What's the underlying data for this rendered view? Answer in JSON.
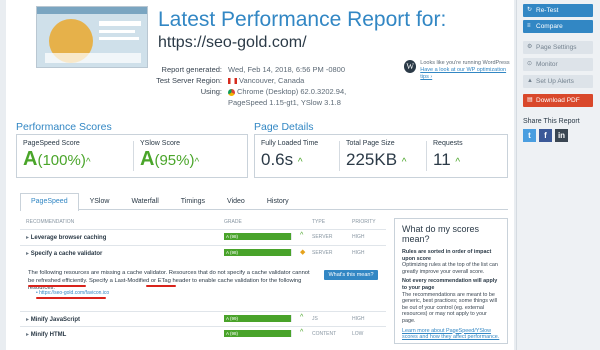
{
  "header": {
    "title": "Latest Performance Report for:",
    "url": "https://seo-gold.com/",
    "meta": [
      {
        "k": "Report generated:",
        "v": "Wed, Feb 14, 2018, 6:56 PM -0800"
      },
      {
        "k": "Test Server Region:",
        "v": "Vancouver, Canada"
      },
      {
        "k": "Using:",
        "v": "Chrome (Desktop) 62.0.3202.94, PageSpeed 1.15-gt1, YSlow 3.1.8"
      }
    ],
    "wp_text": "Looks like you're running WordPress",
    "wp_link": "Have a look at our WP optimization tips ›"
  },
  "scores": {
    "title": "Performance Scores",
    "pagespeed_label": "PageSpeed Score",
    "pagespeed_grade": "A",
    "pagespeed_pct": "(100%)",
    "yslow_label": "YSlow Score",
    "yslow_grade": "A",
    "yslow_pct": "(95%)"
  },
  "details": {
    "title": "Page Details",
    "loaded_label": "Fully Loaded Time",
    "loaded_value": "0.6s",
    "size_label": "Total Page Size",
    "size_value": "225KB",
    "requests_label": "Requests",
    "requests_value": "11"
  },
  "tabs": [
    "PageSpeed",
    "YSlow",
    "Waterfall",
    "Timings",
    "Video",
    "History"
  ],
  "table": {
    "headers": {
      "rec": "RECOMMENDATION",
      "grade": "GRADE",
      "type": "TYPE",
      "priority": "PRIORITY"
    },
    "rows": [
      {
        "name": "Leverage browser caching",
        "grade": "A (98)",
        "pct": 98,
        "type": "SERVER",
        "priority": "HIGH"
      },
      {
        "name": "Specify a cache validator",
        "grade": "A (98)",
        "pct": 98,
        "type": "SERVER",
        "priority": "HIGH"
      },
      {
        "name": "Minify JavaScript",
        "grade": "A (99)",
        "pct": 99,
        "type": "JS",
        "priority": "HIGH"
      },
      {
        "name": "Minify HTML",
        "grade": "A (98)",
        "pct": 98,
        "type": "CONTENT",
        "priority": "LOW"
      }
    ],
    "explanation": "The following resources are missing a cache validator. Resources that do not specify a cache validator cannot be refreshed efficiently. Specify a Last-Modified or ETag header to enable cache validation for the following resources:",
    "button": "What's this mean?",
    "resource": "• https://seo-gold.com/favicon.ico"
  },
  "infobox": {
    "title": "What do my scores mean?",
    "b1": "Rules are sorted in order of impact upon score",
    "p1": "Optimizing rules at the top of the list can greatly improve your overall score.",
    "b2": "Not every recommendation will apply to your page",
    "p2": "The recommendations are meant to be generic, best practices; some things will be out of your control (eg. external resources) or may not apply to your page.",
    "link": "Learn more about PageSpeed/YSlow scores and how they affect performance."
  },
  "sidebar": {
    "retest": "Re-Test",
    "compare": "Compare",
    "page_settings": "Page Settings",
    "monitor": "Monitor",
    "alerts": "Set Up Alerts",
    "pdf": "Download PDF",
    "share_title": "Share This Report"
  },
  "colors": {
    "accent": "#3287c4",
    "good": "#49a32a",
    "danger": "#d9482b"
  }
}
